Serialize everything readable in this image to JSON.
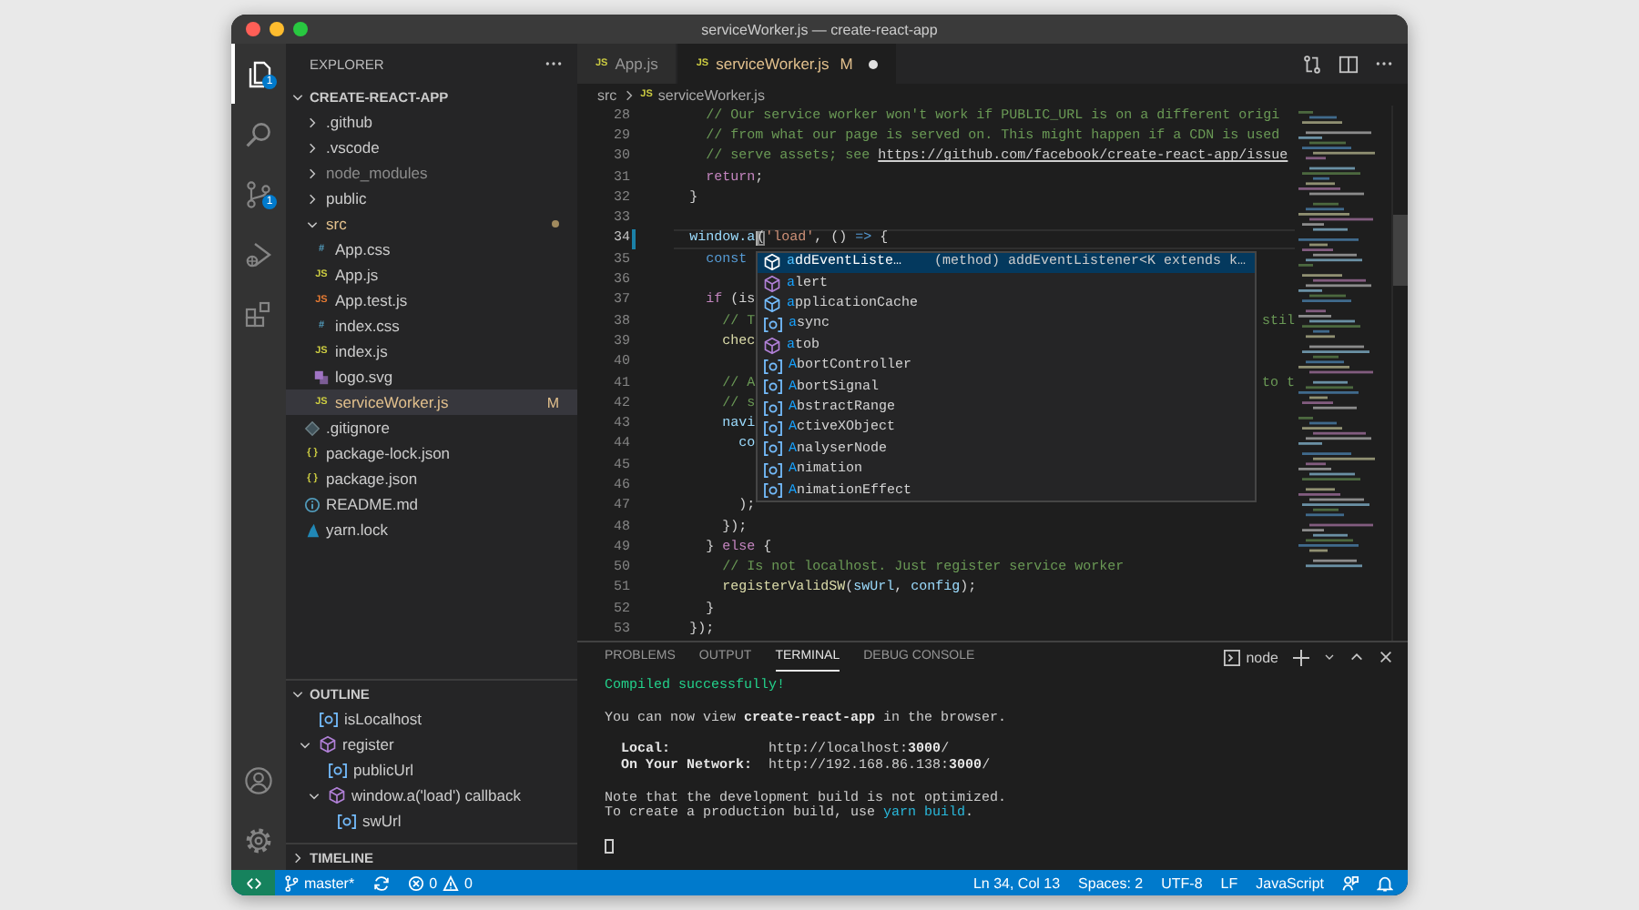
{
  "window": {
    "title": "serviceWorker.js — create-react-app"
  },
  "activity_bar": {
    "items": [
      {
        "kind": "files",
        "selected": true,
        "badge": "1"
      },
      {
        "kind": "search",
        "selected": false
      },
      {
        "kind": "source_control",
        "selected": false,
        "badge": "1"
      },
      {
        "kind": "run",
        "selected": false
      },
      {
        "kind": "extensions",
        "selected": false
      }
    ],
    "bottom": [
      {
        "kind": "account"
      },
      {
        "kind": "settings"
      }
    ]
  },
  "sidebar": {
    "title": "EXPLORER",
    "folder": {
      "title": "CREATE-REACT-APP",
      "expanded": true,
      "items": [
        {
          "name": ".github",
          "kind": "folder",
          "expanded": false,
          "selected": false,
          "modified": false,
          "dimmed": false
        },
        {
          "name": ".vscode",
          "kind": "folder",
          "expanded": false,
          "selected": false,
          "modified": false,
          "dimmed": false
        },
        {
          "name": "node_modules",
          "kind": "folder",
          "expanded": false,
          "selected": false,
          "modified": false,
          "dimmed": true
        },
        {
          "name": "public",
          "kind": "folder",
          "expanded": false,
          "selected": false,
          "modified": false,
          "dimmed": false
        },
        {
          "name": "src",
          "kind": "folder",
          "expanded": true,
          "selected": false,
          "modified": true,
          "dimmed": false,
          "children": [
            {
              "name": "App.css",
              "kind": "css",
              "icon_label": "#",
              "selected": false,
              "modified": false,
              "dimmed": false
            },
            {
              "name": "App.js",
              "kind": "js",
              "icon_label": "JS",
              "selected": false,
              "modified": false,
              "dimmed": false
            },
            {
              "name": "App.test.js",
              "kind": "js_test",
              "icon_label": "JS",
              "selected": false,
              "modified": false,
              "dimmed": false
            },
            {
              "name": "index.css",
              "kind": "css",
              "icon_label": "#",
              "selected": false,
              "modified": false,
              "dimmed": false
            },
            {
              "name": "index.js",
              "kind": "js",
              "icon_label": "JS",
              "selected": false,
              "modified": false,
              "dimmed": false
            },
            {
              "name": "logo.svg",
              "kind": "svg",
              "selected": false,
              "modified": false,
              "dimmed": false
            },
            {
              "name": "serviceWorker.js",
              "kind": "js",
              "icon_label": "JS",
              "selected": true,
              "modified": true,
              "dimmed": false,
              "status": "M"
            }
          ]
        },
        {
          "name": ".gitignore",
          "kind": "gitignore",
          "selected": false,
          "modified": false,
          "dimmed": false
        },
        {
          "name": "package-lock.json",
          "kind": "json",
          "icon_label": "{ }",
          "selected": false,
          "modified": false,
          "dimmed": false
        },
        {
          "name": "package.json",
          "kind": "json",
          "icon_label": "{ }",
          "selected": false,
          "modified": false,
          "dimmed": false
        },
        {
          "name": "README.md",
          "kind": "readme",
          "selected": false,
          "modified": false,
          "dimmed": false
        },
        {
          "name": "yarn.lock",
          "kind": "yarn",
          "selected": false,
          "modified": false,
          "dimmed": false
        }
      ]
    },
    "outline": {
      "title": "OUTLINE",
      "expanded": true,
      "items": [
        {
          "name": "isLocalhost",
          "kind": "variable"
        },
        {
          "name": "register",
          "kind": "function",
          "expanded": true,
          "children": [
            {
              "name": "publicUrl",
              "kind": "variable"
            },
            {
              "name": "window.a('load') callback",
              "kind": "function",
              "expanded": true,
              "children": [
                {
                  "name": "swUrl",
                  "kind": "variable"
                }
              ]
            }
          ]
        }
      ]
    },
    "timeline": {
      "title": "TIMELINE",
      "expanded": false
    }
  },
  "editor": {
    "tabs": [
      {
        "label": "App.js",
        "kind": "js",
        "icon_label": "JS",
        "selected": false,
        "modified": false,
        "dirty": false
      },
      {
        "label": "serviceWorker.js",
        "kind": "js",
        "icon_label": "JS",
        "selected": true,
        "modified": true,
        "dirty": true,
        "status": "M"
      }
    ],
    "breadcrumbs": [
      {
        "label": "src",
        "kind": "folder"
      },
      {
        "label": "serviceWorker.js",
        "kind": "js",
        "icon_label": "JS"
      }
    ],
    "lines": [
      {
        "number": "28",
        "current": false,
        "changed": false,
        "tokens": [
          {
            "kind": "comment",
            "text": "    // Our service worker won't work if PUBLIC_URL is on a different origi"
          }
        ]
      },
      {
        "number": "29",
        "current": false,
        "changed": false,
        "tokens": [
          {
            "kind": "comment",
            "text": "    // from what our page is served on. This might happen if a CDN is used"
          }
        ]
      },
      {
        "number": "30",
        "current": false,
        "changed": false,
        "tokens": [
          {
            "kind": "comment",
            "text": "    // serve assets; see "
          },
          {
            "kind": "link",
            "text": "https://github.com/facebook/create-react-app/issue"
          }
        ]
      },
      {
        "number": "31",
        "current": false,
        "changed": false,
        "tokens": [
          {
            "kind": "keyword",
            "text": "    return"
          },
          {
            "kind": "plain",
            "text": ";"
          }
        ]
      },
      {
        "number": "32",
        "current": false,
        "changed": false,
        "tokens": [
          {
            "kind": "plain",
            "text": "  }"
          }
        ]
      },
      {
        "number": "33",
        "current": false,
        "changed": false
      },
      {
        "number": "34",
        "current": true,
        "changed": true,
        "tokens": [
          {
            "kind": "variable",
            "text": "  window.a"
          },
          {
            "kind": "bracket_match",
            "text": "("
          },
          {
            "kind": "string",
            "text": "'load'"
          },
          {
            "kind": "plain",
            "text": ", () "
          },
          {
            "kind": "storage",
            "text": "=>"
          },
          {
            "kind": "plain",
            "text": " {"
          }
        ]
      },
      {
        "number": "35",
        "current": false,
        "changed": false,
        "tokens": [
          {
            "kind": "storage",
            "text": "    const"
          }
        ]
      },
      {
        "number": "36",
        "current": false,
        "changed": false
      },
      {
        "number": "37",
        "current": false,
        "changed": false,
        "tokens": [
          {
            "kind": "keyword",
            "text": "    if"
          },
          {
            "kind": "plain",
            "text": " (is"
          }
        ]
      },
      {
        "number": "38",
        "current": false,
        "changed": false,
        "tokens": [
          {
            "kind": "comment",
            "text": "      // T"
          }
        ],
        "tail": [
          {
            "kind": "comment",
            "text": "stil"
          }
        ]
      },
      {
        "number": "39",
        "current": false,
        "changed": false,
        "tokens": [
          {
            "kind": "function",
            "text": "      chec"
          }
        ]
      },
      {
        "number": "40",
        "current": false,
        "changed": false
      },
      {
        "number": "41",
        "current": false,
        "changed": false,
        "tokens": [
          {
            "kind": "comment",
            "text": "      // A"
          }
        ],
        "tail": [
          {
            "kind": "comment",
            "text": "to t"
          }
        ]
      },
      {
        "number": "42",
        "current": false,
        "changed": false,
        "tokens": [
          {
            "kind": "comment",
            "text": "      // s"
          }
        ]
      },
      {
        "number": "43",
        "current": false,
        "changed": false,
        "tokens": [
          {
            "kind": "variable",
            "text": "      navi"
          }
        ]
      },
      {
        "number": "44",
        "current": false,
        "changed": false,
        "tokens": [
          {
            "kind": "variable",
            "text": "        co"
          }
        ]
      },
      {
        "number": "45",
        "current": false,
        "changed": false
      },
      {
        "number": "46",
        "current": false,
        "changed": false
      },
      {
        "number": "47",
        "current": false,
        "changed": false,
        "tokens": [
          {
            "kind": "plain",
            "text": "        );"
          }
        ]
      },
      {
        "number": "48",
        "current": false,
        "changed": false,
        "tokens": [
          {
            "kind": "plain",
            "text": "      });"
          }
        ]
      },
      {
        "number": "49",
        "current": false,
        "changed": false,
        "tokens": [
          {
            "kind": "plain",
            "text": "    } "
          },
          {
            "kind": "keyword",
            "text": "else"
          },
          {
            "kind": "plain",
            "text": " {"
          }
        ]
      },
      {
        "number": "50",
        "current": false,
        "changed": false,
        "tokens": [
          {
            "kind": "comment",
            "text": "      // Is not localhost. Just register service worker"
          }
        ]
      },
      {
        "number": "51",
        "current": false,
        "changed": false,
        "tokens": [
          {
            "kind": "function",
            "text": "      registerValidSW"
          },
          {
            "kind": "plain",
            "text": "("
          },
          {
            "kind": "variable",
            "text": "swUrl"
          },
          {
            "kind": "plain",
            "text": ", "
          },
          {
            "kind": "variable",
            "text": "config"
          },
          {
            "kind": "plain",
            "text": ");"
          }
        ]
      },
      {
        "number": "52",
        "current": false,
        "changed": false,
        "tokens": [
          {
            "kind": "plain",
            "text": "    }"
          }
        ]
      },
      {
        "number": "53",
        "current": false,
        "changed": false,
        "tokens": [
          {
            "kind": "plain",
            "text": "  });"
          }
        ]
      }
    ],
    "suggestions": [
      {
        "label": "addEventListe…",
        "kind": "method",
        "selected": true,
        "detail": "(method) addEventListener<K extends k…"
      },
      {
        "label": "alert",
        "kind": "method",
        "selected": false
      },
      {
        "label": "applicationCache",
        "kind": "property",
        "selected": false
      },
      {
        "label": "async",
        "kind": "variable",
        "selected": false
      },
      {
        "label": "atob",
        "kind": "method",
        "selected": false
      },
      {
        "label": "AbortController",
        "kind": "variable",
        "selected": false
      },
      {
        "label": "AbortSignal",
        "kind": "variable",
        "selected": false
      },
      {
        "label": "AbstractRange",
        "kind": "variable",
        "selected": false
      },
      {
        "label": "ActiveXObject",
        "kind": "variable",
        "selected": false
      },
      {
        "label": "AnalyserNode",
        "kind": "variable",
        "selected": false
      },
      {
        "label": "Animation",
        "kind": "variable",
        "selected": false
      },
      {
        "label": "AnimationEffect",
        "kind": "variable",
        "selected": false
      }
    ]
  },
  "panel": {
    "tabs": [
      {
        "label": "PROBLEMS",
        "selected": false
      },
      {
        "label": "OUTPUT",
        "selected": false
      },
      {
        "label": "TERMINAL",
        "selected": true
      },
      {
        "label": "DEBUG CONSOLE",
        "selected": false
      }
    ],
    "terminal_name": "node",
    "terminal": [
      [
        [
          {
            "kind": "success",
            "text": "Compiled successfully!"
          }
        ]
      ],
      [
        [
          {
            "kind": "plain",
            "text": "You can now view "
          },
          {
            "kind": "bold",
            "text": "create-react-app"
          },
          {
            "kind": "plain",
            "text": " in the browser."
          }
        ]
      ],
      [
        [
          {
            "kind": "bold",
            "text": "  Local:"
          },
          {
            "kind": "plain",
            "text": "            http://localhost:"
          },
          {
            "kind": "bold",
            "text": "3000"
          },
          {
            "kind": "plain",
            "text": "/"
          }
        ],
        [
          {
            "kind": "bold",
            "text": "  On Your Network:"
          },
          {
            "kind": "plain",
            "text": "  http://192.168.86.138:"
          },
          {
            "kind": "bold",
            "text": "3000"
          },
          {
            "kind": "plain",
            "text": "/"
          }
        ]
      ],
      [
        [
          {
            "kind": "plain",
            "text": "Note that the development build is not optimized."
          }
        ],
        [
          {
            "kind": "plain",
            "text": "To create a production build, use "
          },
          {
            "kind": "command",
            "text": "yarn build"
          },
          {
            "kind": "plain",
            "text": "."
          }
        ]
      ]
    ],
    "cursor": true
  },
  "status_bar": {
    "branch": "master*",
    "errors": "0",
    "warnings": "0",
    "items": [
      "Ln 34, Col 13",
      "Spaces: 2",
      "UTF-8",
      "LF",
      "JavaScript"
    ]
  }
}
